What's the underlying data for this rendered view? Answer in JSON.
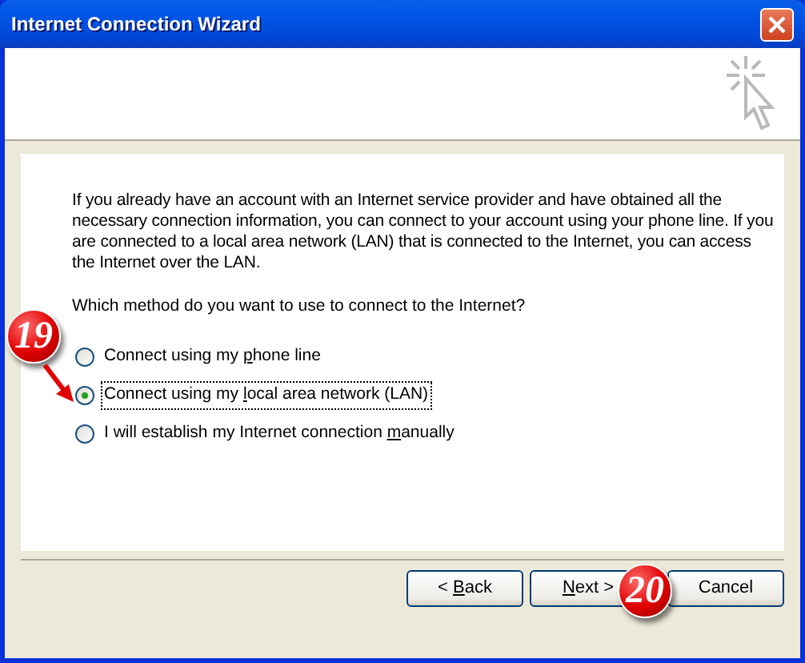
{
  "window": {
    "title": "Internet Connection Wizard"
  },
  "intro": "If you already have an account with an Internet service provider and have obtained all the necessary connection information, you can connect to your account using your phone line. If you are connected to a local area network (LAN) that is connected to the Internet, you can access the Internet over the LAN.",
  "question": "Which method do you want to use to connect to the Internet?",
  "options": [
    {
      "label": {
        "before": "Connect using my ",
        "key": "p",
        "after": "hone line"
      },
      "selected": false,
      "focused": false
    },
    {
      "label": {
        "before": "Connect using my ",
        "key": "l",
        "after": "ocal area network (LAN)"
      },
      "selected": true,
      "focused": true
    },
    {
      "label": {
        "before": "I will establish my Internet connection ",
        "key": "m",
        "after": "anually"
      },
      "selected": false,
      "focused": false
    }
  ],
  "buttons": [
    {
      "label": {
        "before": "< ",
        "key": "B",
        "after": "ack"
      },
      "default": false
    },
    {
      "label": {
        "key": "N",
        "after": "ext >"
      },
      "default": false
    },
    {
      "label": {
        "before": "Cancel"
      },
      "default": false
    }
  ],
  "callouts": [
    {
      "number": "19"
    },
    {
      "number": "20"
    }
  ]
}
